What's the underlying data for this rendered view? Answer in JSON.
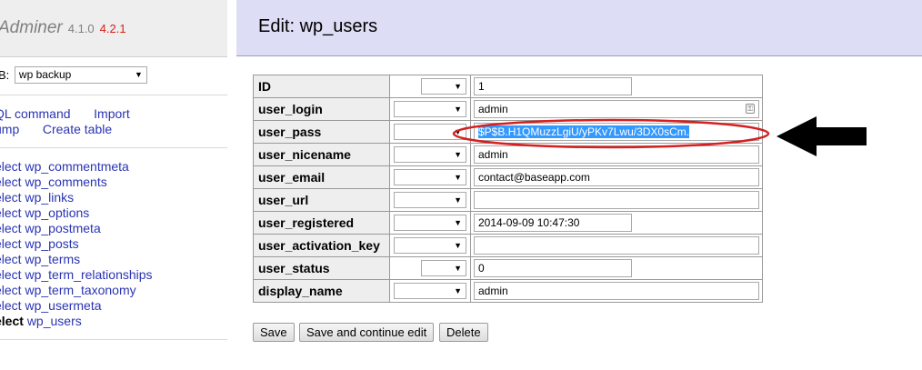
{
  "app": {
    "name": "Adminer",
    "version": "4.1.0",
    "new_version": "4.2.1"
  },
  "database": {
    "label": "B:",
    "selected": "wp backup"
  },
  "links": {
    "sql_command": "QL command",
    "import": "Import",
    "dump": "ump",
    "create_table": "Create table"
  },
  "tables": [
    {
      "action": "elect",
      "name": "wp_commentmeta"
    },
    {
      "action": "elect",
      "name": "wp_comments"
    },
    {
      "action": "elect",
      "name": "wp_links"
    },
    {
      "action": "elect",
      "name": "wp_options"
    },
    {
      "action": "elect",
      "name": "wp_postmeta"
    },
    {
      "action": "elect",
      "name": "wp_posts"
    },
    {
      "action": "elect",
      "name": "wp_terms"
    },
    {
      "action": "elect",
      "name": "wp_term_relationships"
    },
    {
      "action": "elect",
      "name": "wp_term_taxonomy"
    },
    {
      "action": "elect",
      "name": "wp_usermeta"
    },
    {
      "action": "elect",
      "name": "wp_users"
    }
  ],
  "page": {
    "title": "Edit: wp_users"
  },
  "fields": [
    {
      "name": "ID",
      "value": "1"
    },
    {
      "name": "user_login",
      "value": "admin"
    },
    {
      "name": "user_pass",
      "value": "$P$B.H1QMuzzLgiU/yPKv7Lwu/3DX0sCm."
    },
    {
      "name": "user_nicename",
      "value": "admin"
    },
    {
      "name": "user_email",
      "value": "contact@baseapp.com"
    },
    {
      "name": "user_url",
      "value": ""
    },
    {
      "name": "user_registered",
      "value": "2014-09-09 10:47:30"
    },
    {
      "name": "user_activation_key",
      "value": ""
    },
    {
      "name": "user_status",
      "value": "0"
    },
    {
      "name": "display_name",
      "value": "admin"
    }
  ],
  "buttons": {
    "save": "Save",
    "save_continue": "Save and continue edit",
    "delete": "Delete"
  },
  "colors": {
    "link": "#2a34b3",
    "version_new": "#d4201a",
    "header_bg": "#ddddf5",
    "highlight_ellipse": "#d42020",
    "selection": "#3399ff"
  }
}
